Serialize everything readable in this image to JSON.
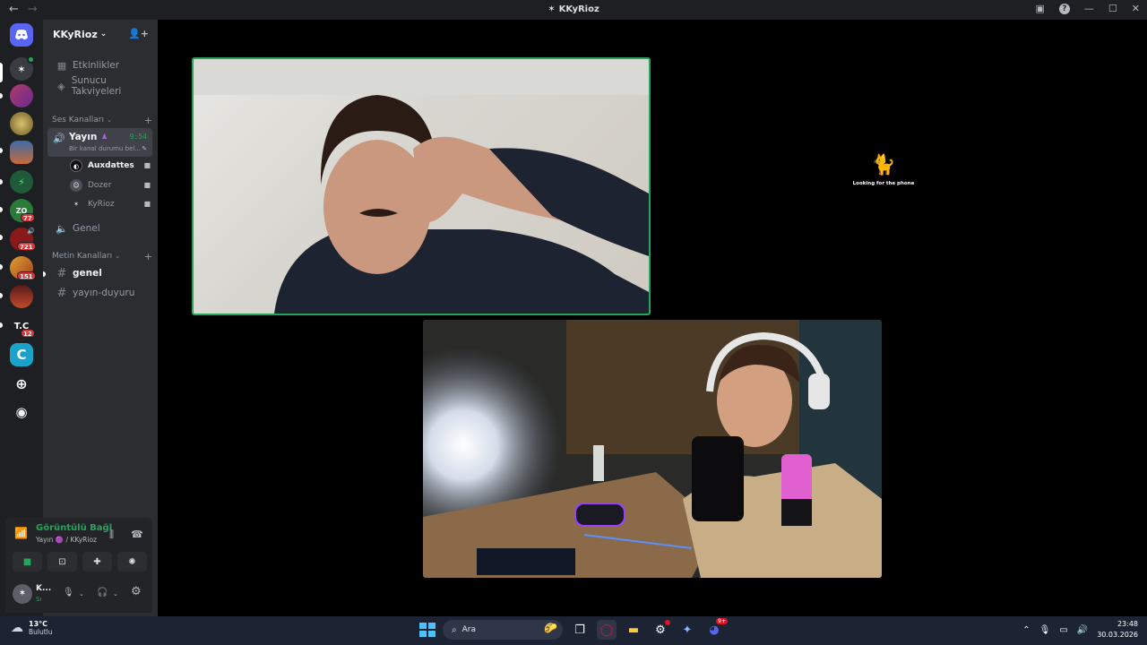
{
  "window": {
    "title": "KKyRioz",
    "back": "←",
    "forward": "→",
    "help": "?"
  },
  "rail": {
    "badges": [
      "77",
      "721",
      "151",
      "12"
    ],
    "text_server": "T.C"
  },
  "guild": {
    "name": "KKyRioz",
    "chevron": "⌄"
  },
  "sidebar": {
    "events": "Etkinlikler",
    "boosts": "Sunucu Takviyeleri",
    "voice_category": "Ses Kanalları",
    "active_voice": {
      "name": "Yayın",
      "time": "9:54",
      "status": "Bir kanal durumu bel..."
    },
    "voice_users": [
      {
        "name": "Auxdattes",
        "bold": true
      },
      {
        "name": "Dozer",
        "bold": false
      },
      {
        "name": "KyRioz",
        "bold": false
      }
    ],
    "general_voice": "Genel",
    "text_category": "Metin Kanalları",
    "text_channels": [
      {
        "name": "genel",
        "unread": true
      },
      {
        "name": "yayın-duyuru",
        "unread": false
      }
    ]
  },
  "voice_panel": {
    "status": "Görüntülü Bağl",
    "subtitle": "Yayın 🟣 / KKyRioz"
  },
  "user_panel": {
    "name": "K...",
    "status": "Sı"
  },
  "stage": {
    "nocam_caption": "Looking for the phone"
  },
  "taskbar": {
    "temp": "13°C",
    "condition": "Bulutlu",
    "search_placeholder": "Ara",
    "time": "23:48",
    "date": "30.03.2026",
    "discord_badge": "9+"
  },
  "colors": {
    "accent_green": "#23a55a",
    "notify_red": "#da373c",
    "blurple": "#5865f2"
  }
}
